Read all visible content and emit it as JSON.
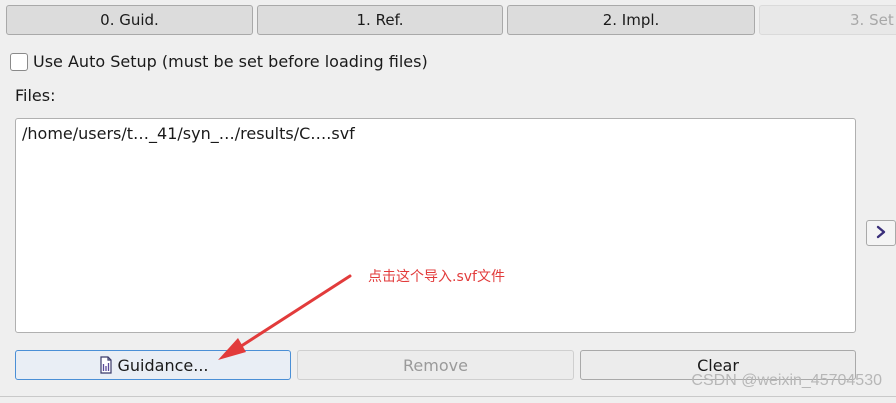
{
  "tabs": [
    {
      "label": "0. Guid."
    },
    {
      "label": "1. Ref."
    },
    {
      "label": "2. Impl."
    },
    {
      "label": "3. Set"
    }
  ],
  "auto_setup": {
    "label": "Use Auto Setup (must be set before loading files)",
    "checked": false
  },
  "files": {
    "label": "Files:",
    "items": [
      "/home/users/t…_41/syn_…/results/C….svf"
    ]
  },
  "buttons": {
    "guidance": "Guidance...",
    "remove": "Remove",
    "clear": "Clear"
  },
  "annotation": {
    "text": "点击这个导入.svf文件",
    "color": "#e23b3b"
  },
  "watermark": "CSDN @weixin_45704530",
  "icons": {
    "expand": "chevron-right-icon",
    "guidance": "document-icon"
  }
}
